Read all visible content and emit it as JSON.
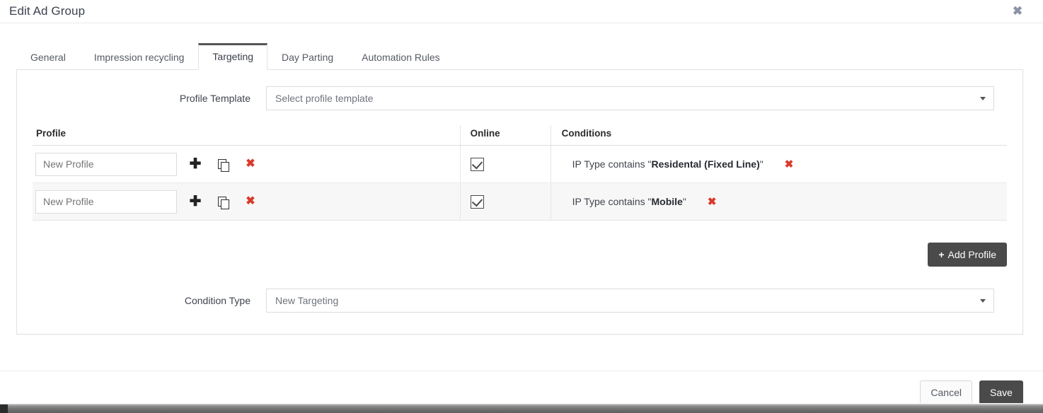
{
  "header": {
    "title": "Edit Ad Group",
    "close_icon": "close-icon"
  },
  "tabs": [
    {
      "label": "General",
      "active": false
    },
    {
      "label": "Impression recycling",
      "active": false
    },
    {
      "label": "Targeting",
      "active": true
    },
    {
      "label": "Day Parting",
      "active": false
    },
    {
      "label": "Automation Rules",
      "active": false
    }
  ],
  "profile_template": {
    "label": "Profile Template",
    "value": "Select profile template",
    "caret_icon": "chevron-down-icon"
  },
  "table": {
    "columns": [
      "Profile",
      "Online",
      "Conditions"
    ],
    "rows": [
      {
        "profile_placeholder": "New Profile",
        "profile_value": "",
        "online_checked": true,
        "condition_prefix": "IP Type contains \"",
        "condition_value": "Residental (Fixed Line)",
        "condition_suffix": "\"",
        "add_icon": "plus-icon",
        "copy_icon": "copy-icon",
        "delete_icon": "delete-x-icon",
        "condition_remove_icon": "remove-condition-x-icon"
      },
      {
        "profile_placeholder": "New Profile",
        "profile_value": "",
        "online_checked": true,
        "condition_prefix": "IP Type contains \"",
        "condition_value": "Mobile",
        "condition_suffix": "\"",
        "add_icon": "plus-icon",
        "copy_icon": "copy-icon",
        "delete_icon": "delete-x-icon",
        "condition_remove_icon": "remove-condition-x-icon"
      }
    ]
  },
  "add_profile": {
    "plus": "+",
    "label": "Add Profile"
  },
  "condition_type": {
    "label": "Condition Type",
    "value": "New Targeting",
    "caret_icon": "chevron-down-icon"
  },
  "footer": {
    "cancel_label": "Cancel",
    "save_label": "Save"
  },
  "colors": {
    "accent_dark": "#4a4a4a",
    "danger": "#d9392b",
    "text": "#3f444d",
    "border": "#e2e2e2",
    "row_alt": "#f7f7f7",
    "close_icon": "#8a93a8"
  }
}
